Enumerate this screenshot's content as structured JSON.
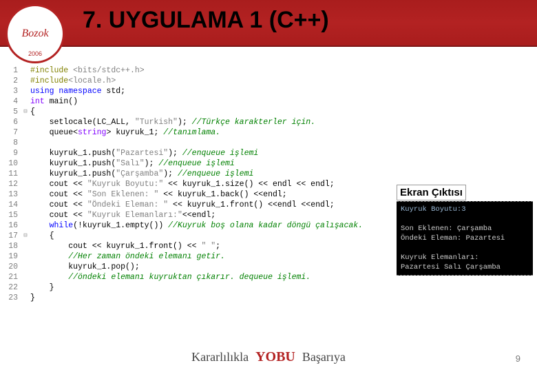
{
  "header": {
    "title": "7. UYGULAMA 1 (C++)",
    "logo_text": "Bozok",
    "logo_year": "2006"
  },
  "code": {
    "lines": [
      {
        "n": 1,
        "fold": "",
        "tokens": [
          {
            "t": "#include",
            "c": "c-pre"
          },
          {
            "t": " ",
            "c": ""
          },
          {
            "t": "<bits/stdc++.h>",
            "c": "c-str"
          }
        ]
      },
      {
        "n": 2,
        "fold": "",
        "tokens": [
          {
            "t": "#include",
            "c": "c-pre"
          },
          {
            "t": "<locale.h>",
            "c": "c-str"
          }
        ]
      },
      {
        "n": 3,
        "fold": "",
        "tokens": [
          {
            "t": "using namespace",
            "c": "c-kw"
          },
          {
            "t": " std;",
            "c": "c-id"
          }
        ]
      },
      {
        "n": 4,
        "fold": "",
        "tokens": [
          {
            "t": "int",
            "c": "c-type"
          },
          {
            "t": " main",
            "c": "c-id"
          },
          {
            "t": "()",
            "c": "c-pun"
          }
        ]
      },
      {
        "n": 5,
        "fold": "⊟",
        "tokens": [
          {
            "t": "{",
            "c": "c-pun"
          }
        ]
      },
      {
        "n": 6,
        "fold": "",
        "tokens": [
          {
            "t": "    setlocale(LC_ALL, ",
            "c": "c-id"
          },
          {
            "t": "\"Turkish\"",
            "c": "c-str"
          },
          {
            "t": "); ",
            "c": "c-pun"
          },
          {
            "t": "//Türkçe karakterler için.",
            "c": "c-cmt"
          }
        ]
      },
      {
        "n": 7,
        "fold": "",
        "tokens": [
          {
            "t": "    queue<",
            "c": "c-id"
          },
          {
            "t": "string",
            "c": "c-type"
          },
          {
            "t": "> kuyruk_1; ",
            "c": "c-id"
          },
          {
            "t": "//tanımlama.",
            "c": "c-cmt"
          }
        ]
      },
      {
        "n": 8,
        "fold": "",
        "tokens": [
          {
            "t": "",
            "c": ""
          }
        ]
      },
      {
        "n": 9,
        "fold": "",
        "tokens": [
          {
            "t": "    kuyruk_1.push(",
            "c": "c-id"
          },
          {
            "t": "\"Pazartesi\"",
            "c": "c-str"
          },
          {
            "t": "); ",
            "c": "c-pun"
          },
          {
            "t": "//enqueue işlemi",
            "c": "c-cmt"
          }
        ]
      },
      {
        "n": 10,
        "fold": "",
        "tokens": [
          {
            "t": "    kuyruk_1.push(",
            "c": "c-id"
          },
          {
            "t": "\"Salı\"",
            "c": "c-str"
          },
          {
            "t": "); ",
            "c": "c-pun"
          },
          {
            "t": "//enqueue işlemi",
            "c": "c-cmt"
          }
        ]
      },
      {
        "n": 11,
        "fold": "",
        "tokens": [
          {
            "t": "    kuyruk_1.push(",
            "c": "c-id"
          },
          {
            "t": "\"Çarşamba\"",
            "c": "c-str"
          },
          {
            "t": "); ",
            "c": "c-pun"
          },
          {
            "t": "//enqueue işlemi",
            "c": "c-cmt"
          }
        ]
      },
      {
        "n": 12,
        "fold": "",
        "tokens": [
          {
            "t": "    cout << ",
            "c": "c-id"
          },
          {
            "t": "\"Kuyruk Boyutu:\"",
            "c": "c-str"
          },
          {
            "t": " << kuyruk_1.size() << endl << endl;",
            "c": "c-id"
          }
        ]
      },
      {
        "n": 13,
        "fold": "",
        "tokens": [
          {
            "t": "    cout << ",
            "c": "c-id"
          },
          {
            "t": "\"Son Eklenen: \"",
            "c": "c-str"
          },
          {
            "t": " << kuyruk_1.back() <<endl;",
            "c": "c-id"
          }
        ]
      },
      {
        "n": 14,
        "fold": "",
        "tokens": [
          {
            "t": "    cout << ",
            "c": "c-id"
          },
          {
            "t": "\"Öndeki Eleman: \"",
            "c": "c-str"
          },
          {
            "t": " << kuyruk_1.front() <<endl <<endl;",
            "c": "c-id"
          }
        ]
      },
      {
        "n": 15,
        "fold": "",
        "tokens": [
          {
            "t": "    cout << ",
            "c": "c-id"
          },
          {
            "t": "\"Kuyruk Elemanları:\"",
            "c": "c-str"
          },
          {
            "t": "<<endl;",
            "c": "c-id"
          }
        ]
      },
      {
        "n": 16,
        "fold": "",
        "tokens": [
          {
            "t": "    ",
            "c": ""
          },
          {
            "t": "while",
            "c": "c-kw"
          },
          {
            "t": "(!kuyruk_1.empty()) ",
            "c": "c-id"
          },
          {
            "t": "//Kuyruk boş olana kadar döngü çalışacak.",
            "c": "c-cmt"
          }
        ]
      },
      {
        "n": 17,
        "fold": "⊟",
        "tokens": [
          {
            "t": "    {",
            "c": "c-pun"
          }
        ]
      },
      {
        "n": 18,
        "fold": "",
        "tokens": [
          {
            "t": "        cout << kuyruk_1.front() << ",
            "c": "c-id"
          },
          {
            "t": "\" \"",
            "c": "c-str"
          },
          {
            "t": ";",
            "c": "c-pun"
          }
        ]
      },
      {
        "n": 19,
        "fold": "",
        "tokens": [
          {
            "t": "        ",
            "c": ""
          },
          {
            "t": "//Her zaman öndeki elemanı getir.",
            "c": "c-cmt"
          }
        ]
      },
      {
        "n": 20,
        "fold": "",
        "tokens": [
          {
            "t": "        kuyruk_1.pop();",
            "c": "c-id"
          }
        ]
      },
      {
        "n": 21,
        "fold": "",
        "tokens": [
          {
            "t": "        ",
            "c": ""
          },
          {
            "t": "//öndeki elemanı kuyruktan çıkarır. dequeue işlemi.",
            "c": "c-cmt"
          }
        ]
      },
      {
        "n": 22,
        "fold": "",
        "tokens": [
          {
            "t": "    }",
            "c": "c-pun"
          }
        ]
      },
      {
        "n": 23,
        "fold": "",
        "tokens": [
          {
            "t": "}",
            "c": "c-pun"
          }
        ]
      }
    ]
  },
  "output": {
    "label": "Ekran Çıktısı",
    "lines": [
      {
        "text": "Kuyruk Boyutu:3",
        "cls": "title-line"
      },
      {
        "text": "",
        "cls": ""
      },
      {
        "text": "Son Eklenen: Çarşamba",
        "cls": ""
      },
      {
        "text": "Öndeki Eleman: Pazartesi",
        "cls": ""
      },
      {
        "text": "",
        "cls": ""
      },
      {
        "text": "Kuyruk Elemanları:",
        "cls": ""
      },
      {
        "text": "Pazartesi Salı Çarşamba",
        "cls": ""
      }
    ]
  },
  "footer": {
    "motto_left": "Kararlılıkla",
    "brand": "YOBU",
    "motto_right": "Başarıya"
  },
  "page_number": "9"
}
